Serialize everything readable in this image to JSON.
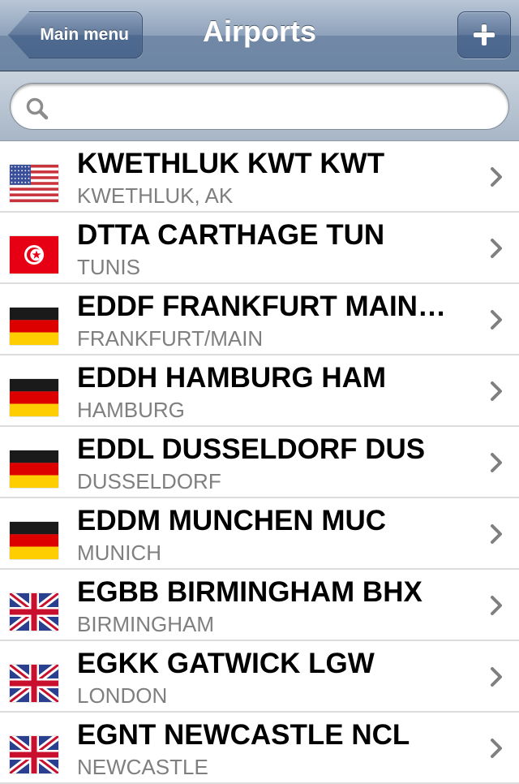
{
  "navbar": {
    "back_label": "Main menu",
    "title": "Airports",
    "add_icon": "plus-icon"
  },
  "search": {
    "value": "",
    "icon": "search-icon"
  },
  "colors": {
    "navbar": "#6d86a4",
    "subtitle": "#7f7f7f",
    "chevron": "#808080"
  },
  "airports": [
    {
      "title": "KWETHLUK KWT KWT",
      "subtitle": "KWETHLUK, AK",
      "flag": "us-flag-icon"
    },
    {
      "title": "DTTA CARTHAGE TUN",
      "subtitle": "TUNIS",
      "flag": "tunisia-flag-icon"
    },
    {
      "title": "EDDF FRANKFURT MAIN…",
      "subtitle": "FRANKFURT/MAIN",
      "flag": "germany-flag-icon"
    },
    {
      "title": "EDDH HAMBURG HAM",
      "subtitle": "HAMBURG",
      "flag": "germany-flag-icon"
    },
    {
      "title": "EDDL DUSSELDORF DUS",
      "subtitle": "DUSSELDORF",
      "flag": "germany-flag-icon"
    },
    {
      "title": "EDDM MUNCHEN MUC",
      "subtitle": "MUNICH",
      "flag": "germany-flag-icon"
    },
    {
      "title": "EGBB BIRMINGHAM BHX",
      "subtitle": "BIRMINGHAM",
      "flag": "uk-flag-icon"
    },
    {
      "title": "EGKK GATWICK LGW",
      "subtitle": "LONDON",
      "flag": "uk-flag-icon"
    },
    {
      "title": "EGNT NEWCASTLE NCL",
      "subtitle": "NEWCASTLE",
      "flag": "uk-flag-icon"
    }
  ]
}
